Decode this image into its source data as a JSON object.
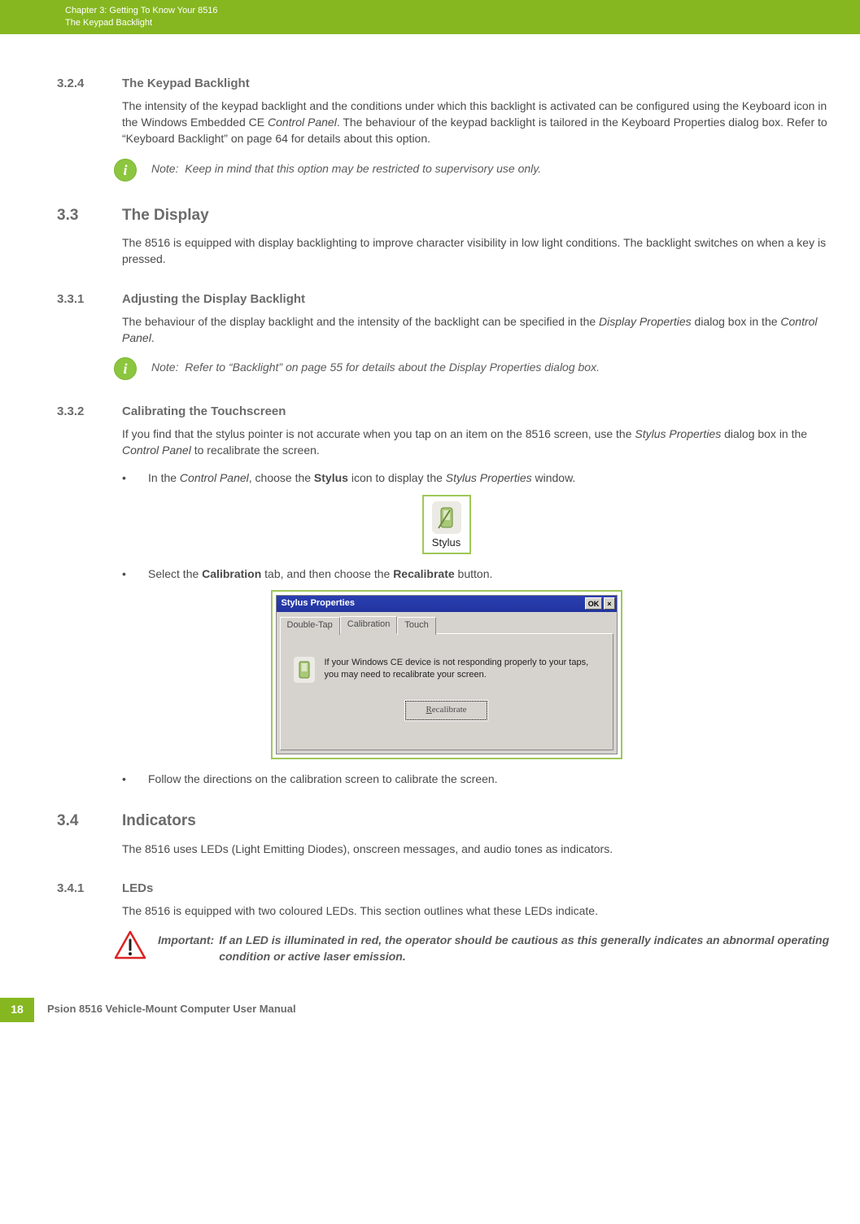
{
  "header": {
    "chapter_line": "Chapter 3:  Getting To Know Your 8516",
    "subtitle": "The Keypad Backlight"
  },
  "s324": {
    "num": "3.2.4",
    "title": "The Keypad Backlight",
    "para_before_term": "The intensity of the keypad backlight and the conditions under which this backlight is activated can be configured using the Keyboard icon in the Windows Embedded CE ",
    "term": "Control Panel",
    "para_after_term": ". The behaviour of the keypad backlight is tailored in the Keyboard Properties dialog box. Refer to “Keyboard Backlight” on page 64 for details about this option.",
    "note_label": "Note:",
    "note_text": "Keep in mind that this option may be restricted to supervisory use only."
  },
  "s33": {
    "num": "3.3",
    "title": "The Display",
    "para": "The 8516 is equipped with display backlighting to improve character visibility in low light conditions. The backlight switches on when a key is pressed."
  },
  "s331": {
    "num": "3.3.1",
    "title": "Adjusting the Display Backlight",
    "p1a": "The behaviour of the display backlight and the intensity of the backlight can be specified in the ",
    "p1b": "Display Properties",
    "p1c": " dialog box in the ",
    "p1d": "Control Panel",
    "p1e": ".",
    "note_label": "Note:",
    "note_text": "Refer to “Backlight” on page 55 for details about the Display Properties dialog box."
  },
  "s332": {
    "num": "3.3.2",
    "title": "Calibrating the Touchscreen",
    "p1a": "If you find that the stylus pointer is not accurate when you tap on an item on the 8516 screen, use the ",
    "p1b": "Stylus Properties",
    "p1c": " dialog box in the ",
    "p1d": "Control Panel",
    "p1e": " to recalibrate the screen.",
    "b1a": "In the ",
    "b1b": "Control Panel",
    "b1c": ", choose the ",
    "b1d": "Stylus",
    "b1e": " icon to display the ",
    "b1f": "Stylus Properties",
    "b1g": " window.",
    "stylus_label": "Stylus",
    "b2a": "Select the ",
    "b2b": "Calibration",
    "b2c": " tab, and then choose the ",
    "b2d": "Recalibrate",
    "b2e": " button.",
    "dialog": {
      "title": "Stylus Properties",
      "ok": "OK",
      "close": "×",
      "tab1": "Double-Tap",
      "tab2": "Calibration",
      "tab3": "Touch",
      "msg": "If your Windows CE device is not responding properly to your taps, you may need to recalibrate your screen.",
      "btn_u": "R",
      "btn_rest": "ecalibrate"
    },
    "b3": "Follow the directions on the calibration screen to calibrate the screen."
  },
  "s34": {
    "num": "3.4",
    "title": "Indicators",
    "para": "The 8516 uses LEDs (Light Emitting Diodes), onscreen messages, and audio tones as indicators."
  },
  "s341": {
    "num": "3.4.1",
    "title": "LEDs",
    "para": "The 8516 is equipped with two coloured LEDs. This section outlines what these LEDs indicate.",
    "warn_label": "Important:",
    "warn_text": "If an LED is illuminated in red, the operator should be cautious as this generally indicates an abnormal operating condition or active laser emission."
  },
  "footer": {
    "page": "18",
    "text": "Psion 8516 Vehicle-Mount Computer User Manual"
  }
}
